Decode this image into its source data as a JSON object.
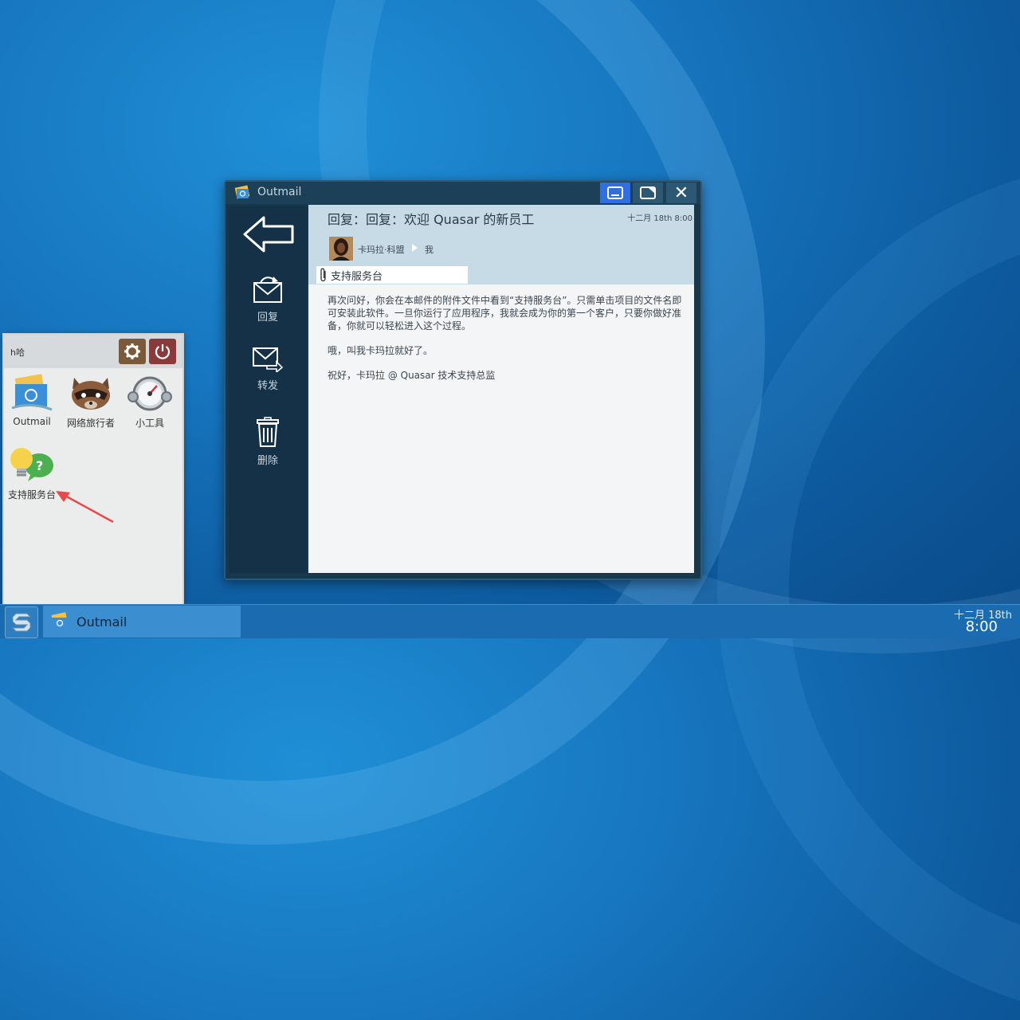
{
  "mail_window": {
    "title": "Outmail",
    "subject": "回复：回复：欢迎 Quasar 的新员工",
    "date": "十二月 18th 8:00",
    "from": "卡玛拉·科盟",
    "to": "我",
    "attachment": "支持服务台",
    "actions": {
      "reply": "回复",
      "forward": "转发",
      "delete": "删除"
    },
    "body": [
      "再次问好，你会在本邮件的附件文件中看到“支持服务台”。只需单击项目的文件名即可安装此软件。一旦你运行了应用程序，我就会成为你的第一个客户，只要你做好准备，你就可以轻松进入这个过程。",
      "哦，叫我卡玛拉就好了。",
      "祝好，卡玛拉 @ Quasar 技术支持总监"
    ]
  },
  "start_menu": {
    "user": "h哈",
    "apps": [
      {
        "label": "Outmail",
        "icon": "mail-app-icon"
      },
      {
        "label": "网络旅行者",
        "icon": "raccoon-browser-icon"
      },
      {
        "label": "小工具",
        "icon": "gauge-tools-icon"
      },
      {
        "label": "支持服务台",
        "icon": "helpdesk-bulb-icon"
      }
    ]
  },
  "taskbar": {
    "task_label": "Outmail",
    "clock_date": "十二月 18th",
    "clock_time": "8:00"
  },
  "colors": {
    "desktop": "#1777c0",
    "window_dark": "#17374d",
    "minimize_active": "#2f6fe0",
    "header_light": "#c7dbe7",
    "annotation": "#e84a4a"
  }
}
